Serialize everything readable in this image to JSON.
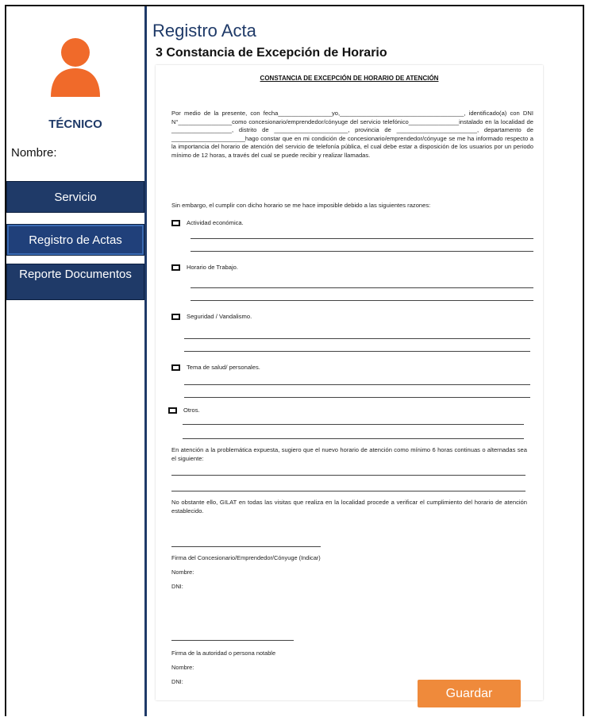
{
  "sidebar": {
    "role": "TÉCNICO",
    "name_label": "Nombre:",
    "items": [
      {
        "label": "Servicio"
      },
      {
        "label": "Registro  de Actas"
      },
      {
        "label": "Reporte Documentos"
      }
    ]
  },
  "header": {
    "title": "Registro Acta",
    "subtitle": "3 Constancia de Excepción de Horario"
  },
  "document": {
    "title": "CONSTANCIA DE EXCEPCIÓN DE HORARIO DE ATENCIÓN",
    "intro": "Por medio de la presente, con fecha________________yo,_____________________________________, identificado(a) con DNI N°________________como concesionario/emprendedor/cónyuge del servicio telefónico_______________instalado en la localidad de __________________, distrito de ______________________, provincia de ________________________, departamento de ______________________hago constar que en mi condición de concesionario/emprendedor/cónyuge se me ha informado respecto a la importancia del horario de atención del servicio de telefonía pública, el cual debe estar a disposición de los usuarios por un periodo mínimo de 12 horas, a través del cual se puede recibir y realizar llamadas.",
    "reasons_intro": "Sin embargo, el cumplir con dicho horario se me hace imposible debido a las siguientes razones:",
    "options": [
      "Actividad económica.",
      "Horario de Trabajo.",
      "Seguridad / Vandalismo.",
      "Tema de salud/ personales.",
      "Otros."
    ],
    "suggestion": "En atención a la problemática expuesta, sugiero que el nuevo horario de atención como mínimo 6 horas continuas o alternadas sea el siguiente:",
    "verification": "No obstante ello, GILAT en todas las visitas que realiza en la localidad procede a verificar el cumplimiento del horario de atención establecido.",
    "signature1": "Firma del Concesionario/Emprendedor/Cónyuge     (Indicar)",
    "signature2": "Firma de la autoridad o persona notable",
    "nombre_label": "Nombre:",
    "dni_label": "DNI:"
  },
  "actions": {
    "save_label": "Guardar"
  },
  "colors": {
    "nav": "#1f3a68",
    "accent": "#ef8a3b",
    "avatar": "#f06a2a"
  }
}
